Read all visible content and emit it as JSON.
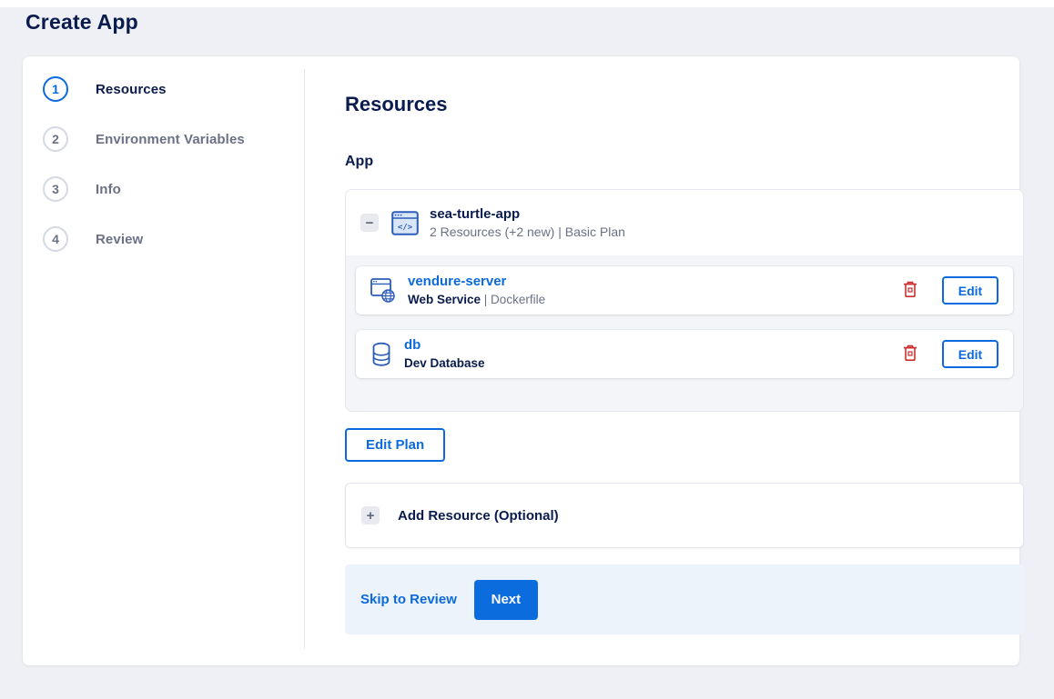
{
  "page": {
    "title": "Create App"
  },
  "stepper": {
    "steps": [
      {
        "number": "1",
        "label": "Resources",
        "active": true
      },
      {
        "number": "2",
        "label": "Environment Variables",
        "active": false
      },
      {
        "number": "3",
        "label": "Info",
        "active": false
      },
      {
        "number": "4",
        "label": "Review",
        "active": false
      }
    ]
  },
  "content": {
    "heading": "Resources",
    "section_label": "App",
    "app_card": {
      "collapse_glyph": "−",
      "name": "sea-turtle-app",
      "meta": "2 Resources (+2 new) | Basic Plan",
      "resources": [
        {
          "name": "vendure-server",
          "type": "Web Service",
          "detail": " | Dockerfile",
          "icon": "web-service-icon",
          "edit_label": "Edit"
        },
        {
          "name": "db",
          "type": "Dev Database",
          "detail": "",
          "icon": "database-icon",
          "edit_label": "Edit"
        }
      ]
    },
    "edit_plan_label": "Edit Plan",
    "add_resource": {
      "plus_glyph": "+",
      "label": "Add Resource (Optional)"
    },
    "footer": {
      "skip_label": "Skip to Review",
      "next_label": "Next"
    }
  },
  "colors": {
    "accent_blue": "#0b6add",
    "button_blue": "#0b6cdd",
    "navy_text": "#0a1b4e",
    "gray_text": "#6b7186",
    "icon_blue": "#2d5cb8",
    "icon_fill": "#d9e6f8",
    "trash_red": "#cf2e2e",
    "page_bg": "#eef0f5",
    "inner_gray_bg": "#f3f5f8",
    "footer_bg": "#edf3fa",
    "border": "#e3e6ec"
  }
}
